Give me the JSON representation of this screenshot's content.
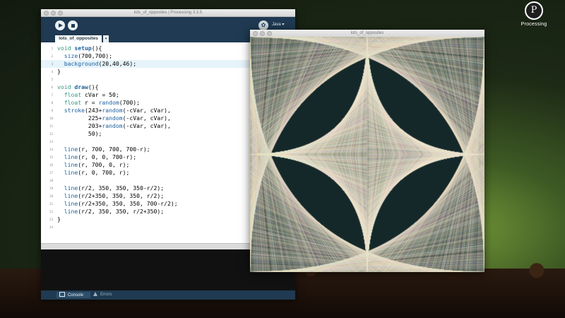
{
  "ide": {
    "title": "lots_of_opposites | Processing 3.3.5",
    "mode": "Java ▾",
    "debug_icon": "debug-icon",
    "tab_label": "lots_of_opposites",
    "tab_menu": "▾",
    "console_label": "Console",
    "errors_label": "Errors",
    "code_lines": [
      {
        "n": "1",
        "html": "<span class=\"kw\">void</span> <span class=\"kb\">setup</span>(){"
      },
      {
        "n": "2",
        "html": "  <span class=\"fn\">size</span>(700,700);"
      },
      {
        "n": "3",
        "html": "  <span class=\"fn\">background</span>(20,40,46);",
        "highlight": true
      },
      {
        "n": "4",
        "html": "}"
      },
      {
        "n": "5",
        "html": ""
      },
      {
        "n": "6",
        "html": "<span class=\"kw\">void</span> <span class=\"kb\">draw</span>(){"
      },
      {
        "n": "7",
        "html": "  <span class=\"kw\">float</span> cVar = 50;"
      },
      {
        "n": "8",
        "html": "  <span class=\"kw\">float</span> r = <span class=\"fn\">random</span>(700);"
      },
      {
        "n": "9",
        "html": "  <span class=\"fn\">stroke</span>(243+<span class=\"fn\">random</span>(-cVar, cVar),"
      },
      {
        "n": "10",
        "html": "         225+<span class=\"fn\">random</span>(-cVar, cVar),"
      },
      {
        "n": "11",
        "html": "         203+<span class=\"fn\">random</span>(-cVar, cVar),"
      },
      {
        "n": "12",
        "html": "         50);"
      },
      {
        "n": "13",
        "html": ""
      },
      {
        "n": "14",
        "html": "  <span class=\"pl\">line</span>(r, 700, 700, 700-r);"
      },
      {
        "n": "15",
        "html": "  <span class=\"pl\">line</span>(r, 0, 0, 700-r);"
      },
      {
        "n": "16",
        "html": "  <span class=\"pl\">line</span>(r, 700, 0, r);"
      },
      {
        "n": "17",
        "html": "  <span class=\"pl\">line</span>(r, 0, 700, r);"
      },
      {
        "n": "18",
        "html": ""
      },
      {
        "n": "19",
        "html": "  <span class=\"pl\">line</span>(r/2, 350, 350, 350-r/2);"
      },
      {
        "n": "20",
        "html": "  <span class=\"pl\">line</span>(r/2+350, 350, 350, r/2);"
      },
      {
        "n": "21",
        "html": "  <span class=\"pl\">line</span>(r/2+350, 350, 350, 700-r/2);"
      },
      {
        "n": "22",
        "html": "  <span class=\"pl\">line</span>(r/2, 350, 350, r/2+350);"
      },
      {
        "n": "23",
        "html": "}"
      },
      {
        "n": "24",
        "html": ""
      }
    ]
  },
  "sketch": {
    "title": "lots_of_opposites",
    "background": "#142829",
    "stroke_base": [
      243,
      225,
      203
    ]
  },
  "logo": {
    "mark": "P",
    "label": "Processing"
  },
  "colors": {
    "toolbar": "#1f3a52",
    "line_highlight": "#e6f3fa",
    "keyword": "#33997e",
    "function": "#1c5f9e"
  }
}
